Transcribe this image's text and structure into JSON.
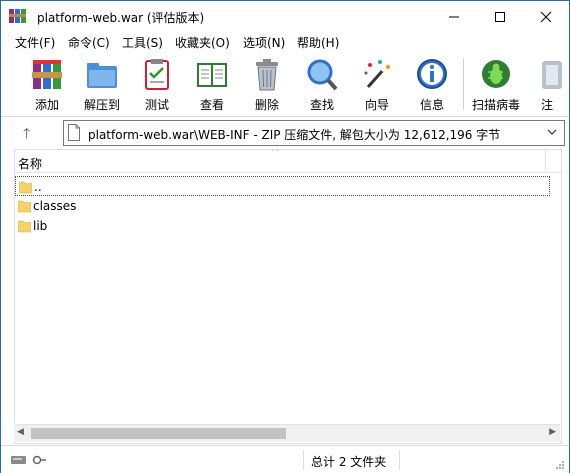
{
  "window": {
    "title": "platform-web.war (评估版本)"
  },
  "menu": [
    {
      "label": "文件(F)"
    },
    {
      "label": "命令(C)"
    },
    {
      "label": "工具(S)"
    },
    {
      "label": "收藏夹(O)"
    },
    {
      "label": "选项(N)"
    },
    {
      "label": "帮助(H)"
    }
  ],
  "toolbar": [
    {
      "label": "添加",
      "icon": "add-archive-icon"
    },
    {
      "label": "解压到",
      "icon": "extract-to-icon"
    },
    {
      "label": "测试",
      "icon": "test-icon"
    },
    {
      "label": "查看",
      "icon": "view-book-icon"
    },
    {
      "label": "删除",
      "icon": "trash-icon"
    },
    {
      "label": "查找",
      "icon": "find-magnifier-icon"
    },
    {
      "label": "向导",
      "icon": "wizard-wand-icon"
    },
    {
      "label": "信息",
      "icon": "info-icon"
    },
    {
      "label": "扫描病毒",
      "icon": "virus-scan-icon"
    }
  ],
  "address": {
    "path": "platform-web.war\\WEB-INF - ZIP 压缩文件, 解包大小为 12,612,196 字节"
  },
  "list": {
    "column_name": "名称",
    "items": [
      {
        "name": ".."
      },
      {
        "name": "classes"
      },
      {
        "name": "lib"
      }
    ]
  },
  "status": {
    "summary": "总计 2 文件夹"
  },
  "colors": {
    "folder": "#f5d36b",
    "accent": "#2b6aa8",
    "close_red": "#e81123"
  }
}
